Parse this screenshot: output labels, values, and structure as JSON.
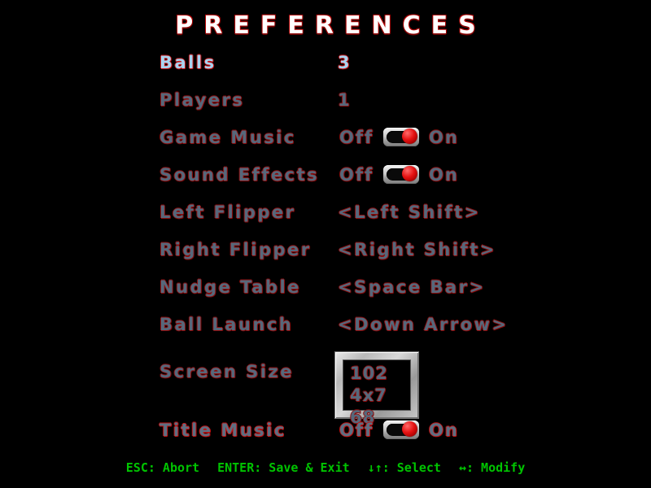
{
  "screen": {
    "title": "PREFERENCES",
    "background_color": "#000000",
    "accent_color": "#8e0d0d",
    "selected_color": "#a8d4f0",
    "label_color": "#56687b",
    "status_color": "#00c400"
  },
  "menu": {
    "selected_index": 0,
    "rows": [
      {
        "name": "balls",
        "label": "Balls",
        "type": "number",
        "value": "3",
        "selected": true
      },
      {
        "name": "players",
        "label": "Players",
        "type": "number",
        "value": "1",
        "selected": false
      },
      {
        "name": "game-music",
        "label": "Game Music",
        "type": "toggle",
        "off_label": "Off",
        "on_label": "On",
        "state": "on",
        "selected": false
      },
      {
        "name": "sound-effects",
        "label": "Sound Effects",
        "type": "toggle",
        "off_label": "Off",
        "on_label": "On",
        "state": "on",
        "selected": false
      },
      {
        "name": "left-flipper",
        "label": "Left Flipper",
        "type": "keybind",
        "value": "<Left Shift>",
        "selected": false
      },
      {
        "name": "right-flipper",
        "label": "Right Flipper",
        "type": "keybind",
        "value": "<Right Shift>",
        "selected": false
      },
      {
        "name": "nudge-table",
        "label": "Nudge Table",
        "type": "keybind",
        "value": "<Space Bar>",
        "selected": false
      },
      {
        "name": "ball-launch",
        "label": "Ball Launch",
        "type": "keybind",
        "value": "<Down Arrow>",
        "selected": false
      },
      {
        "name": "screen-size",
        "label": "Screen Size",
        "type": "monitor",
        "value": "1024x768",
        "selected": false
      },
      {
        "name": "title-music",
        "label": "Title Music",
        "type": "toggle",
        "off_label": "Off",
        "on_label": "On",
        "state": "on",
        "selected": false,
        "bright": true
      }
    ]
  },
  "statusbar": {
    "hints": [
      {
        "name": "abort",
        "text": "ESC: Abort"
      },
      {
        "name": "save-exit",
        "text": "ENTER: Save & Exit"
      },
      {
        "name": "select",
        "text": "↓↑: Select"
      },
      {
        "name": "modify",
        "text": "↔: Modify"
      }
    ]
  }
}
